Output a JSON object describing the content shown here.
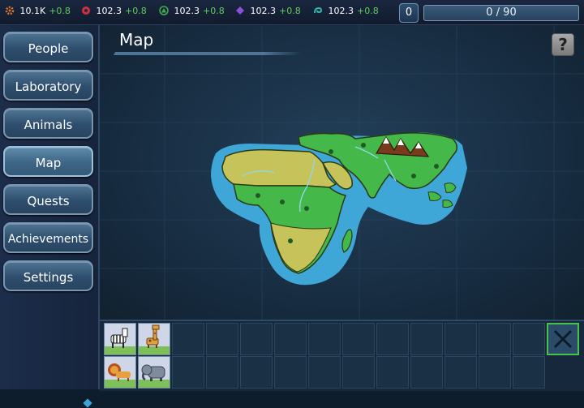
{
  "resources": [
    {
      "icon": "orange-gear-icon",
      "value": "10.1K",
      "inc": "+0.8",
      "color": "#e0752e"
    },
    {
      "icon": "red-cog-icon",
      "value": "102.3",
      "inc": "+0.8",
      "color": "#d0303e"
    },
    {
      "icon": "green-triangle-icon",
      "value": "102.3",
      "inc": "+0.8",
      "color": "#3fae4e"
    },
    {
      "icon": "purple-diamond-icon",
      "value": "102.3",
      "inc": "+0.8",
      "color": "#8a4fd4"
    },
    {
      "icon": "teal-swirl-icon",
      "value": "102.3",
      "inc": "+0.8",
      "color": "#2fb5a5"
    }
  ],
  "header": {
    "slot_count": "0",
    "progress_text": "0 / 90",
    "progress_fraction": 0
  },
  "sidebar": {
    "items": [
      {
        "label": "People"
      },
      {
        "label": "Laboratory"
      },
      {
        "label": "Animals"
      },
      {
        "label": "Map"
      },
      {
        "label": "Quests"
      },
      {
        "label": "Achievements"
      },
      {
        "label": "Settings"
      }
    ],
    "active": "Map"
  },
  "main": {
    "title": "Map",
    "help_label": "?"
  },
  "inventory": {
    "animals": [
      "zebra",
      "giraffe",
      "lion",
      "elephant"
    ]
  },
  "colors": {
    "accent": "#49c24a",
    "panel": "#2e4e6e"
  }
}
